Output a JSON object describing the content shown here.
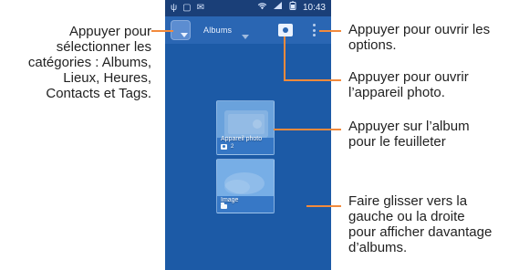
{
  "status_bar": {
    "time": "10:43",
    "left_icons": [
      "usb-icon",
      "screenshot-icon",
      "message-icon"
    ],
    "right_icons": [
      "wifi-icon",
      "signal-icon",
      "battery-icon"
    ]
  },
  "action_bar": {
    "albums_title": "Albums",
    "camera_icon": "camera-icon",
    "overflow_icon": "overflow-menu-icon"
  },
  "albums": [
    {
      "title": "Appareil photo",
      "count": "2",
      "icon": "camera-icon"
    },
    {
      "title": "Image",
      "icon": "folder-icon"
    }
  ],
  "callouts": {
    "left_categories": [
      "Appuyer pour",
      "sélectionner les",
      "catégories : Albums,",
      "Lieux, Heures,",
      "Contacts et Tags."
    ],
    "open_options": [
      "Appuyer pour ouvrir les",
      "options."
    ],
    "open_camera": [
      "Appuyer pour ouvrir",
      "l’appareil photo."
    ],
    "browse_album": [
      "Appuyer sur l’album",
      "pour le feuilleter"
    ],
    "swipe_more": [
      "Faire glisser vers la",
      "gauche ou la droite",
      "pour afficher davantage",
      "d’albums."
    ]
  },
  "colors": {
    "phone_bg": "#1c5aa6",
    "callout_line": "#f28a3c"
  }
}
